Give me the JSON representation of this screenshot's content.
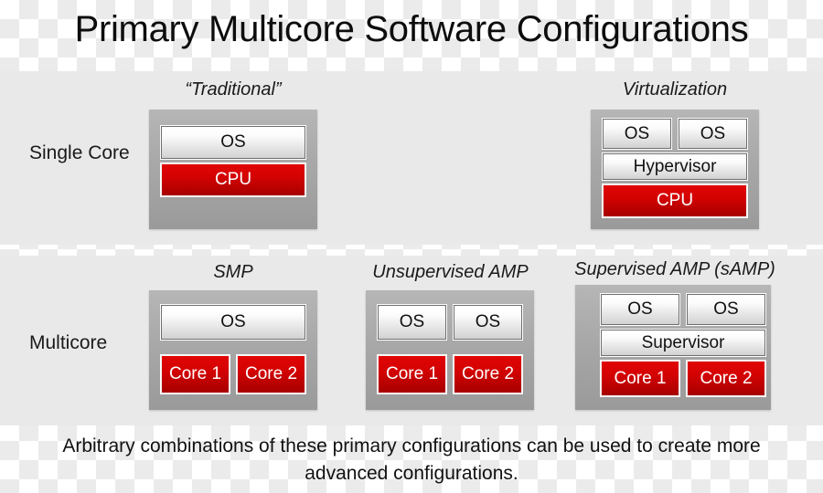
{
  "title": "Primary Multicore Software Configurations",
  "rows": [
    {
      "label": "Single Core"
    },
    {
      "label": "Multicore"
    }
  ],
  "configs": {
    "traditional": {
      "caption": "“Traditional”",
      "os": "OS",
      "cpu": "CPU"
    },
    "virtualization": {
      "caption": "Virtualization",
      "os1": "OS",
      "os2": "OS",
      "hypervisor": "Hypervisor",
      "cpu": "CPU"
    },
    "smp": {
      "caption": "SMP",
      "os": "OS",
      "core1": "Core 1",
      "core2": "Core 2"
    },
    "unsupervised_amp": {
      "caption": "Unsupervised AMP",
      "os1": "OS",
      "os2": "OS",
      "core1": "Core 1",
      "core2": "Core 2"
    },
    "supervised_amp": {
      "caption": "Supervised AMP (sAMP)",
      "os1": "OS",
      "os2": "OS",
      "supervisor": "Supervisor",
      "core1": "Core 1",
      "core2": "Core 2"
    }
  },
  "footer": "Arbitrary combinations of these primary configurations can be used to create more advanced configurations.",
  "colors": {
    "panel_background": "#e9e9e9",
    "chip_gray": "#a8a8a8",
    "core_red_top": "#e10505",
    "core_red_bottom": "#a70000",
    "text": "#111111"
  }
}
